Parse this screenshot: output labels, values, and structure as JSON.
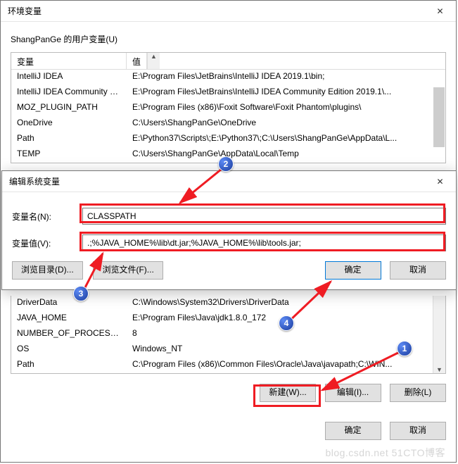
{
  "envWindow": {
    "title": "环境变量",
    "userVarsLabel": "ShangPanGe 的用户变量(U)",
    "columns": {
      "name": "变量",
      "value": "值"
    },
    "userVars": [
      {
        "name": "IntelliJ IDEA",
        "value": "E:\\Program Files\\JetBrains\\IntelliJ IDEA 2019.1\\bin;"
      },
      {
        "name": "IntelliJ IDEA Community E...",
        "value": "E:\\Program Files\\JetBrains\\IntelliJ IDEA Community Edition 2019.1\\..."
      },
      {
        "name": "MOZ_PLUGIN_PATH",
        "value": "E:\\Program Files (x86)\\Foxit Software\\Foxit Phantom\\plugins\\"
      },
      {
        "name": "OneDrive",
        "value": "C:\\Users\\ShangPanGe\\OneDrive"
      },
      {
        "name": "Path",
        "value": "E:\\Python37\\Scripts\\;E:\\Python37\\;C:\\Users\\ShangPanGe\\AppData\\L..."
      },
      {
        "name": "TEMP",
        "value": "C:\\Users\\ShangPanGe\\AppData\\Local\\Temp"
      }
    ],
    "sysVars": [
      {
        "name": "DriverData",
        "value": "C:\\Windows\\System32\\Drivers\\DriverData"
      },
      {
        "name": "JAVA_HOME",
        "value": "E:\\Program Files\\Java\\jdk1.8.0_172"
      },
      {
        "name": "NUMBER_OF_PROCESSORS",
        "value": "8"
      },
      {
        "name": "OS",
        "value": "Windows_NT"
      },
      {
        "name": "Path",
        "value": "C:\\Program Files (x86)\\Common Files\\Oracle\\Java\\javapath;C:\\WIN..."
      }
    ],
    "buttons": {
      "new": "新建(W)...",
      "edit": "编辑(I)...",
      "delete": "删除(L)",
      "ok": "确定",
      "cancel": "取消"
    }
  },
  "editWindow": {
    "title": "编辑系统变量",
    "nameLabel": "变量名(N):",
    "nameValue": "CLASSPATH",
    "valueLabel": "变量值(V):",
    "valueValue": ".;%JAVA_HOME%\\lib\\dt.jar;%JAVA_HOME%\\lib\\tools.jar;",
    "browseDir": "浏览目录(D)...",
    "browseFile": "浏览文件(F)...",
    "ok": "确定",
    "cancel": "取消"
  },
  "annotations": {
    "n1": "1",
    "n2": "2",
    "n3": "3",
    "n4": "4"
  },
  "watermark": "blog.csdn.net   51CTO博客"
}
